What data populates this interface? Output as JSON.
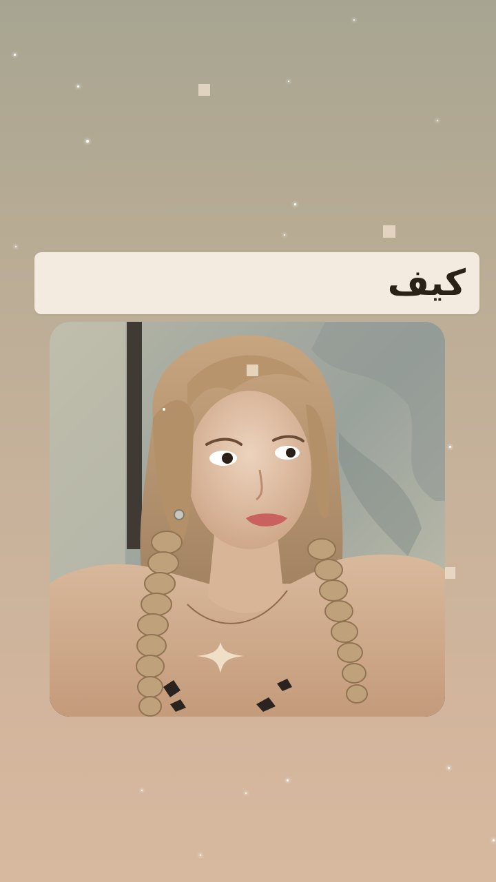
{
  "caption": {
    "text": "كيف"
  },
  "photo": {
    "icon": "portrait-photo",
    "subject": "person-with-braided-hair"
  },
  "decorations": {
    "sparkle_icon": "sparkle-icon",
    "square_icon": "floating-square-icon",
    "background_top": "#a7a592",
    "background_bottom": "#d7b99f",
    "caption_bg": "#f3ebdf",
    "caption_color": "#2a2117"
  }
}
